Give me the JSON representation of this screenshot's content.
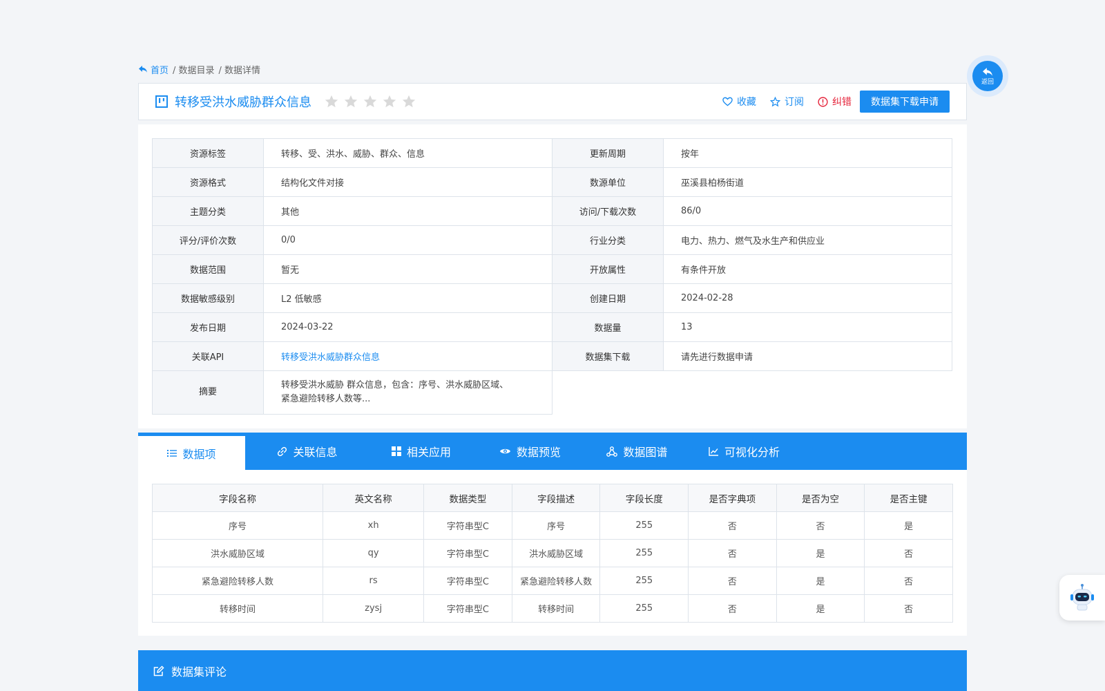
{
  "breadcrumb": {
    "home": "首页",
    "catalog": "/ 数据目录",
    "detail": "/ 数据详情"
  },
  "header": {
    "title": "转移受洪水威胁群众信息",
    "rating_stars": 0,
    "favorite": "收藏",
    "subscribe": "订阅",
    "report": "纠错",
    "apply_button": "数据集下载申请"
  },
  "back_button": {
    "label": "返回"
  },
  "info": {
    "rows": [
      {
        "l1": "资源标签",
        "v1": "转移、受、洪水、威胁、群众、信息",
        "l2": "更新周期",
        "v2": "按年"
      },
      {
        "l1": "资源格式",
        "v1": "结构化文件对接",
        "l2": "数源单位",
        "v2": "巫溪县柏杨街道"
      },
      {
        "l1": "主题分类",
        "v1": "其他",
        "l2": "访问/下载次数",
        "v2": "86/0"
      },
      {
        "l1": "评分/评价次数",
        "v1": "0/0",
        "l2": "行业分类",
        "v2": "电力、热力、燃气及水生产和供应业"
      },
      {
        "l1": "数据范围",
        "v1": "暂无",
        "l2": "开放属性",
        "v2": "有条件开放"
      },
      {
        "l1": "数据敏感级别",
        "v1": "L2 低敏感",
        "l2": "创建日期",
        "v2": "2024-02-28"
      },
      {
        "l1": "发布日期",
        "v1": "2024-03-22",
        "l2": "数据量",
        "v2": "13"
      },
      {
        "l1": "关联API",
        "v1": "转移受洪水威胁群众信息",
        "l2": "数据集下载",
        "v2": "请先进行数据申请"
      }
    ],
    "summary_label": "摘要",
    "summary_line1": "转移受洪水威胁 群众信息，包含：序号、洪水威胁区域、",
    "summary_line2": "紧急避险转移人数等..."
  },
  "tabs": [
    {
      "label": "数据项"
    },
    {
      "label": "关联信息"
    },
    {
      "label": "相关应用"
    },
    {
      "label": "数据预览"
    },
    {
      "label": "数据图谱"
    },
    {
      "label": "可视化分析"
    }
  ],
  "fields": {
    "headers": [
      "字段名称",
      "英文名称",
      "数据类型",
      "字段描述",
      "字段长度",
      "是否字典项",
      "是否为空",
      "是否主键"
    ],
    "rows": [
      [
        "序号",
        "xh",
        "字符串型C",
        "序号",
        "255",
        "否",
        "否",
        "是"
      ],
      [
        "洪水威胁区域",
        "qy",
        "字符串型C",
        "洪水威胁区域",
        "255",
        "否",
        "是",
        "否"
      ],
      [
        "紧急避险转移人数",
        "rs",
        "字符串型C",
        "紧急避险转移人数",
        "255",
        "否",
        "是",
        "否"
      ],
      [
        "转移时间",
        "zysj",
        "字符串型C",
        "转移时间",
        "255",
        "否",
        "是",
        "否"
      ]
    ]
  },
  "comments": {
    "title": "数据集评论"
  },
  "colors": {
    "primary": "#1b8cf0",
    "danger": "#e5243b",
    "star": "#d9d9d9"
  }
}
